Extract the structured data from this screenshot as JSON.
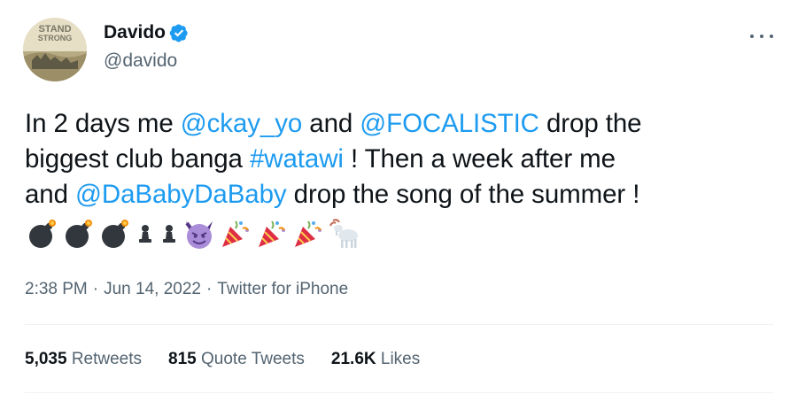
{
  "author": {
    "display_name": "Davido",
    "handle": "@davido",
    "verified_icon": "verified-badge-icon",
    "avatar_text_line1": "STAND",
    "avatar_text_line2": "STRONG"
  },
  "more_icon": "more-options-icon",
  "tweet": {
    "line1_a": "In 2 days me ",
    "line1_mention1": "@ckay_yo",
    "line1_b": " and ",
    "line1_mention2": "@FOCALISTIC",
    "line1_c": " drop the",
    "line2_a": "biggest club banga ",
    "line2_hashtag": "#watawi",
    "line2_b": " ! Then a week after me",
    "line3_a": "and ",
    "line3_mention": "@DaBabyDaBaby",
    "line3_b": " drop the song of the summer !",
    "emojis": [
      "bomb-emoji",
      "bomb-emoji",
      "bomb-emoji",
      "chess-pawn-emoji",
      "chess-pawn-emoji",
      "smiling-devil-emoji",
      "party-popper-emoji",
      "party-popper-emoji",
      "party-popper-emoji",
      "goat-emoji"
    ]
  },
  "meta": {
    "time": "2:38 PM",
    "separator": "·",
    "date": "Jun 14, 2022",
    "source": "Twitter for iPhone"
  },
  "stats": {
    "retweets_count": "5,035",
    "retweets_label": "Retweets",
    "quotes_count": "815",
    "quotes_label": "Quote Tweets",
    "likes_count": "21.6K",
    "likes_label": "Likes"
  },
  "colors": {
    "link": "#1d9bf0",
    "secondary_text": "#536471",
    "primary_text": "#0f1419",
    "divider": "#eff3f4"
  }
}
